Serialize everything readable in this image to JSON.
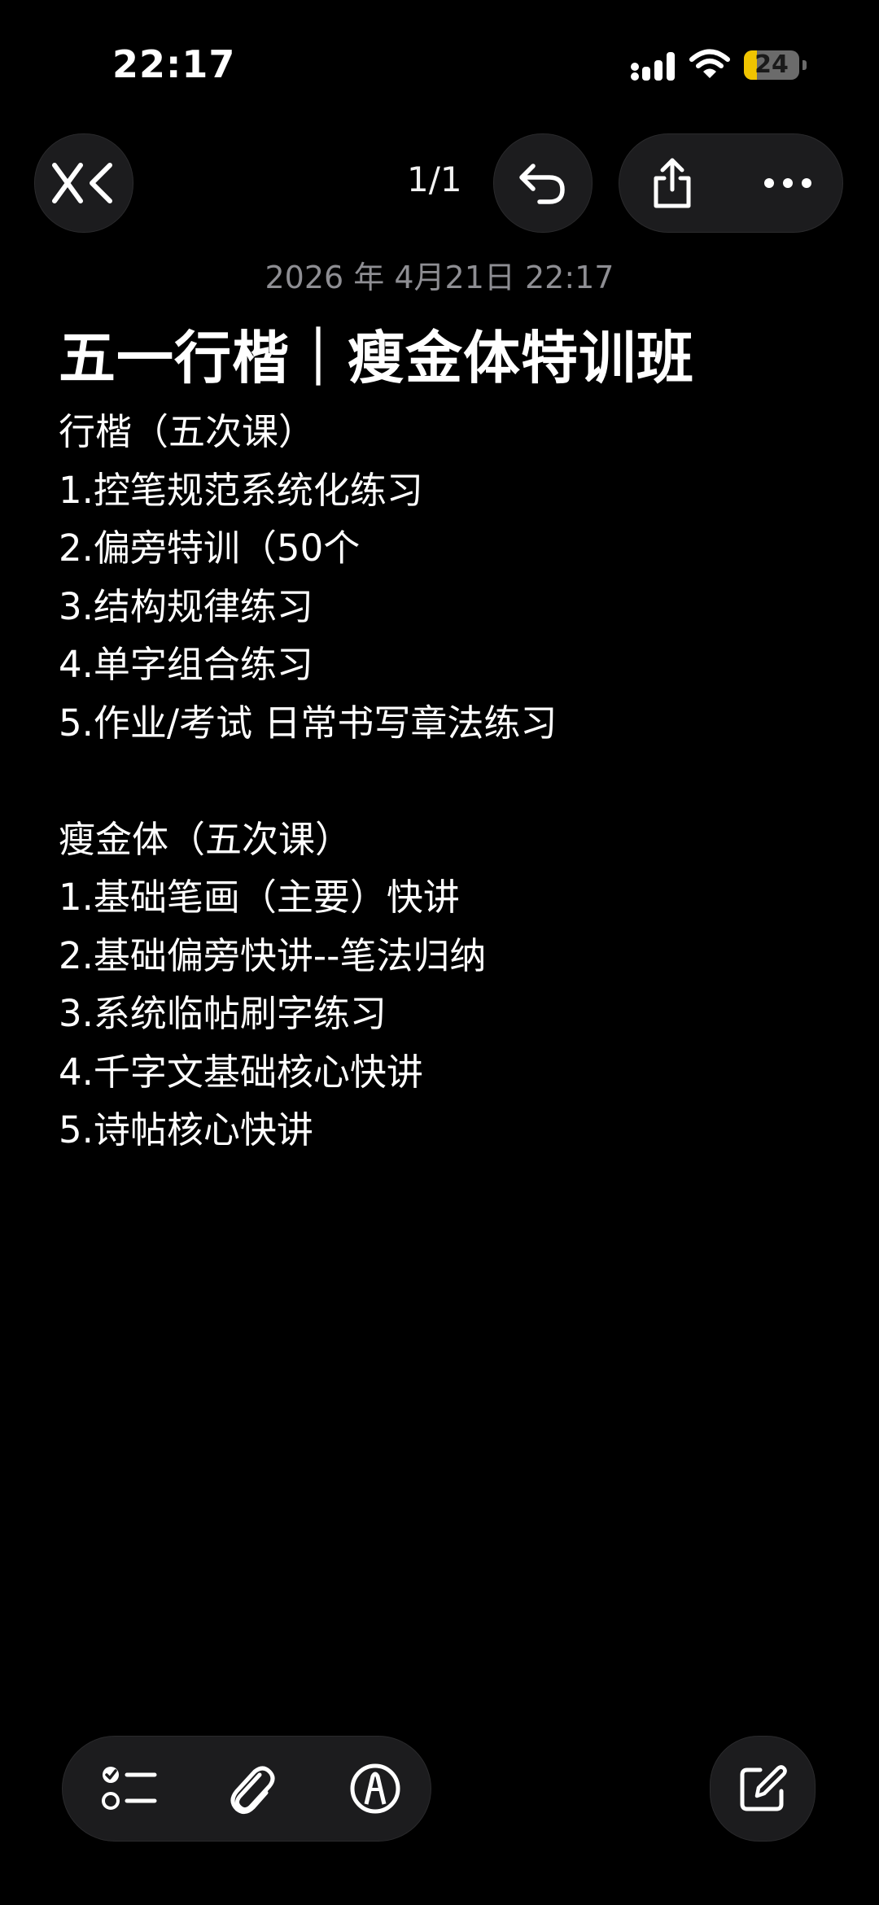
{
  "status_bar": {
    "time": "22:17",
    "battery_level": "24",
    "battery_fraction": 0.24,
    "battery_color": "#f0c400",
    "icons": [
      "signal-icon",
      "wifi-icon",
      "battery-icon"
    ]
  },
  "toolbar": {
    "page_indicator": "1/1",
    "icons": [
      "back-chevron-icon",
      "undo-icon",
      "share-icon",
      "more-icon"
    ]
  },
  "note": {
    "date": "2026 年 4月21日 22:17",
    "title": "五一行楷｜瘦金体特训班",
    "lines": [
      "行楷（五次课）",
      "1.控笔规范系统化练习",
      "2.偏旁特训（50个",
      "3.结构规律练习",
      "4.单字组合练习",
      "5.作业/考试 日常书写章法练习",
      "",
      "瘦金体（五次课）",
      "1.基础笔画（主要）快讲",
      "2.基础偏旁快讲--笔法归纳",
      "3.系统临帖刷字练习",
      "4.千字文基础核心快讲",
      "5.诗帖核心快讲"
    ]
  },
  "bottom_toolbar": {
    "icons": [
      "checklist-icon",
      "paperclip-icon",
      "markup-pen-icon",
      "compose-icon"
    ]
  },
  "colors": {
    "background": "#000000",
    "button_bg": "#1c1c1e",
    "date_text": "#8e8e93",
    "text": "#ffffff"
  }
}
